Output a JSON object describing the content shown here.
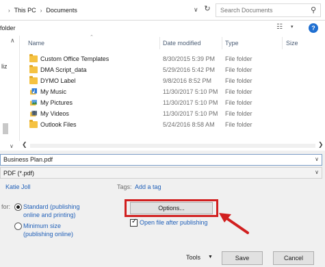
{
  "address_bar": {
    "breadcrumbs": [
      "This PC",
      "Documents"
    ],
    "search_placeholder": "Search Documents"
  },
  "toolbar": {
    "new_folder_label": "folder",
    "help_label": "?"
  },
  "nav_pane": {
    "partial_label": "liz"
  },
  "file_list": {
    "columns": [
      "Name",
      "Date modified",
      "Type",
      "Size"
    ],
    "rows": [
      {
        "name": "Custom Office Templates",
        "date": "8/30/2015 5:39 PM",
        "type": "File folder",
        "icon": "folder-icon"
      },
      {
        "name": "DMA Script_data",
        "date": "5/29/2016 5:42 PM",
        "type": "File folder",
        "icon": "folder-icon"
      },
      {
        "name": "DYMO Label",
        "date": "9/8/2016 8:52 PM",
        "type": "File folder",
        "icon": "folder-icon"
      },
      {
        "name": "My Music",
        "date": "11/30/2017 5:10 PM",
        "type": "File folder",
        "icon": "music-folder-icon"
      },
      {
        "name": "My Pictures",
        "date": "11/30/2017 5:10 PM",
        "type": "File folder",
        "icon": "pictures-folder-icon"
      },
      {
        "name": "My Videos",
        "date": "11/30/2017 5:10 PM",
        "type": "File folder",
        "icon": "videos-folder-icon"
      },
      {
        "name": "Outlook Files",
        "date": "5/24/2016 8:58 AM",
        "type": "File folder",
        "icon": "folder-icon"
      }
    ]
  },
  "save_fields": {
    "file_name": "Business Plan.pdf",
    "file_type": "PDF (*.pdf)"
  },
  "metadata": {
    "author": "Katie Joll",
    "tags_label": "Tags:",
    "tags_value": "Add a tag"
  },
  "optimize": {
    "label": "for:",
    "standard_line1": "Standard (publishing",
    "standard_line2": "online and printing)",
    "minimum_line1": "Minimum size",
    "minimum_line2": "(publishing online)",
    "selected": "standard"
  },
  "options": {
    "button_label": "Options...",
    "open_after_label": "Open file after publishing",
    "open_after_checked": true
  },
  "footer": {
    "tools_label": "Tools",
    "save_label": "Save",
    "cancel_label": "Cancel"
  },
  "colors": {
    "highlight": "#d11f1f",
    "link": "#1f5fb8",
    "help": "#1f6fd1"
  }
}
